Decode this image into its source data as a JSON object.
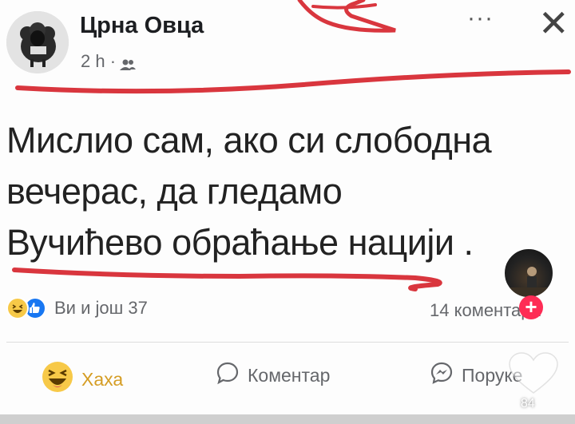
{
  "post": {
    "page_name": "Црна Овца",
    "time": "2 h ·",
    "audience_icon": "friends-icon",
    "more_label": "···",
    "close_label": "✕",
    "lines": [
      "Мислио сам, ако си слободна",
      "вечерас, да гледамо",
      "Вучићево обраћање нацији ."
    ],
    "reactions_text": "Ви и још 37",
    "comments_count": "14 коментара"
  },
  "actions": {
    "haha": "Хаха",
    "comment": "Коментар",
    "share": "Поруке"
  },
  "overlay": {
    "follow_label": "+",
    "like_count": "84"
  },
  "colors": {
    "annotation_red": "#d9363e",
    "haha_yellow": "#f7c948",
    "like_blue": "#1877f2",
    "follow_pink": "#fe2c55"
  }
}
